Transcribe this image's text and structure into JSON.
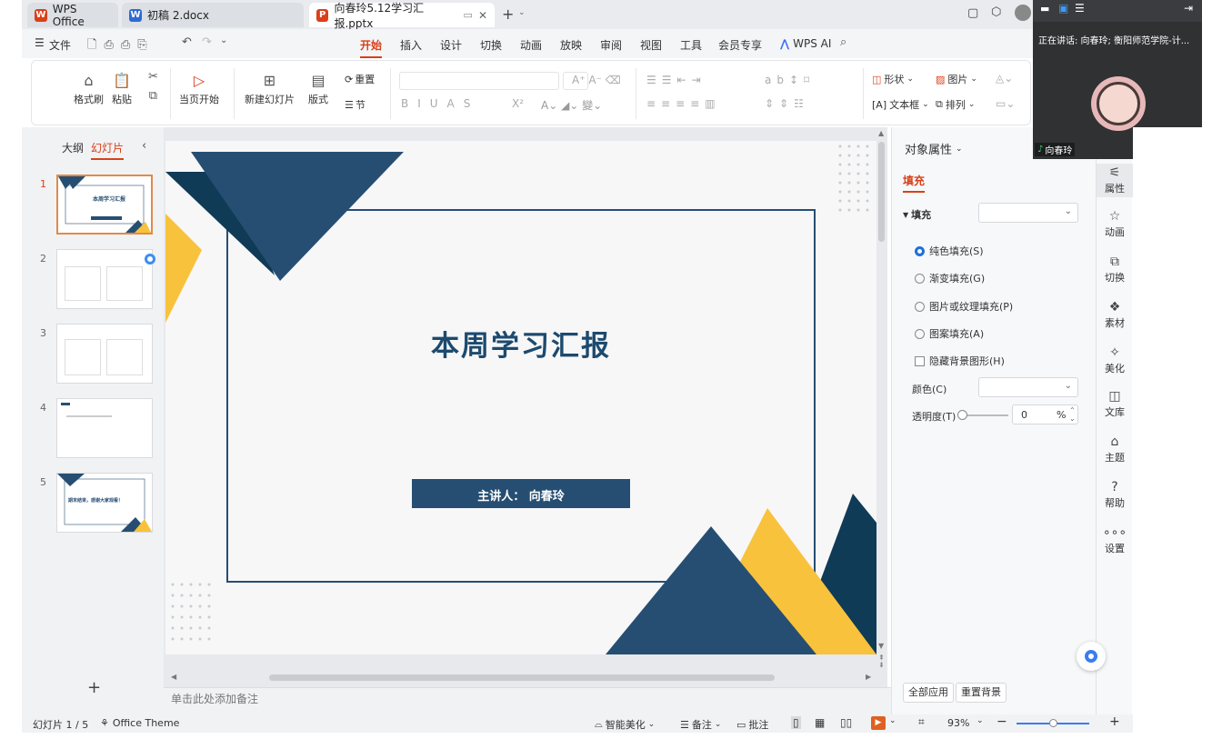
{
  "tabs": [
    {
      "label": "WPS Office",
      "icon": "W",
      "color": "#d8401a"
    },
    {
      "label": "初稿 2.docx",
      "icon": "W",
      "color": "#2b6bd6"
    },
    {
      "label": "向春玲5.12学习汇报.pptx",
      "icon": "P",
      "color": "#d8401a"
    }
  ],
  "menubar": {
    "file": "文件",
    "items": [
      "开始",
      "插入",
      "设计",
      "切换",
      "动画",
      "放映",
      "审阅",
      "视图",
      "工具",
      "会员专享"
    ],
    "wpsai": "WPS AI"
  },
  "ribbon": {
    "format_painter": "格式刷",
    "paste": "粘贴",
    "start_from_current": "当页开始",
    "new_slide": "新建幻灯片",
    "layout": "版式",
    "reset": "重置",
    "section": "节",
    "shape": "形状",
    "picture": "图片",
    "textbox": "文本框",
    "arrange": "排列"
  },
  "leftpanel": {
    "tab_outline": "大纲",
    "tab_slides": "幻灯片",
    "slide_numbers": [
      "1",
      "2",
      "3",
      "4",
      "5"
    ],
    "thumb1_title": "本周学习汇报",
    "thumb5_title": "期末结束，感谢大家观看！",
    "add_icon": "+"
  },
  "slide": {
    "title": "本周学习汇报",
    "presenter": "主讲人：  向春玲",
    "colors": {
      "navy": "#264e72",
      "dark": "#0f3b57",
      "yellow": "#f8c23c",
      "border": "#264e72"
    }
  },
  "notes_placeholder": "单击此处添加备注",
  "rightpanel": {
    "header": "对象属性",
    "tab_fill": "填充",
    "section_fill": "填充",
    "options": [
      "纯色填充(S)",
      "渐变填充(G)",
      "图片或纹理填充(P)",
      "图案填充(A)"
    ],
    "hide_bg": "隐藏背景图形(H)",
    "color_label": "颜色(C)",
    "transparency_label": "透明度(T)",
    "transparency_value": "0",
    "transparency_unit": "%",
    "apply_all": "全部应用",
    "reset_bg": "重置背景"
  },
  "rightrail": [
    "属性",
    "动画",
    "切换",
    "素材",
    "美化",
    "文库",
    "主题",
    "帮助",
    "设置"
  ],
  "statusbar": {
    "slide_count": "幻灯片 1 / 5",
    "theme": "Office Theme",
    "smart_beautify": "智能美化",
    "notes": "备注",
    "comments": "批注",
    "zoom": "93%"
  },
  "video": {
    "speaking": "正在讲话:  向春玲; 衡阳师范学院-计...",
    "name": "向春玲"
  }
}
